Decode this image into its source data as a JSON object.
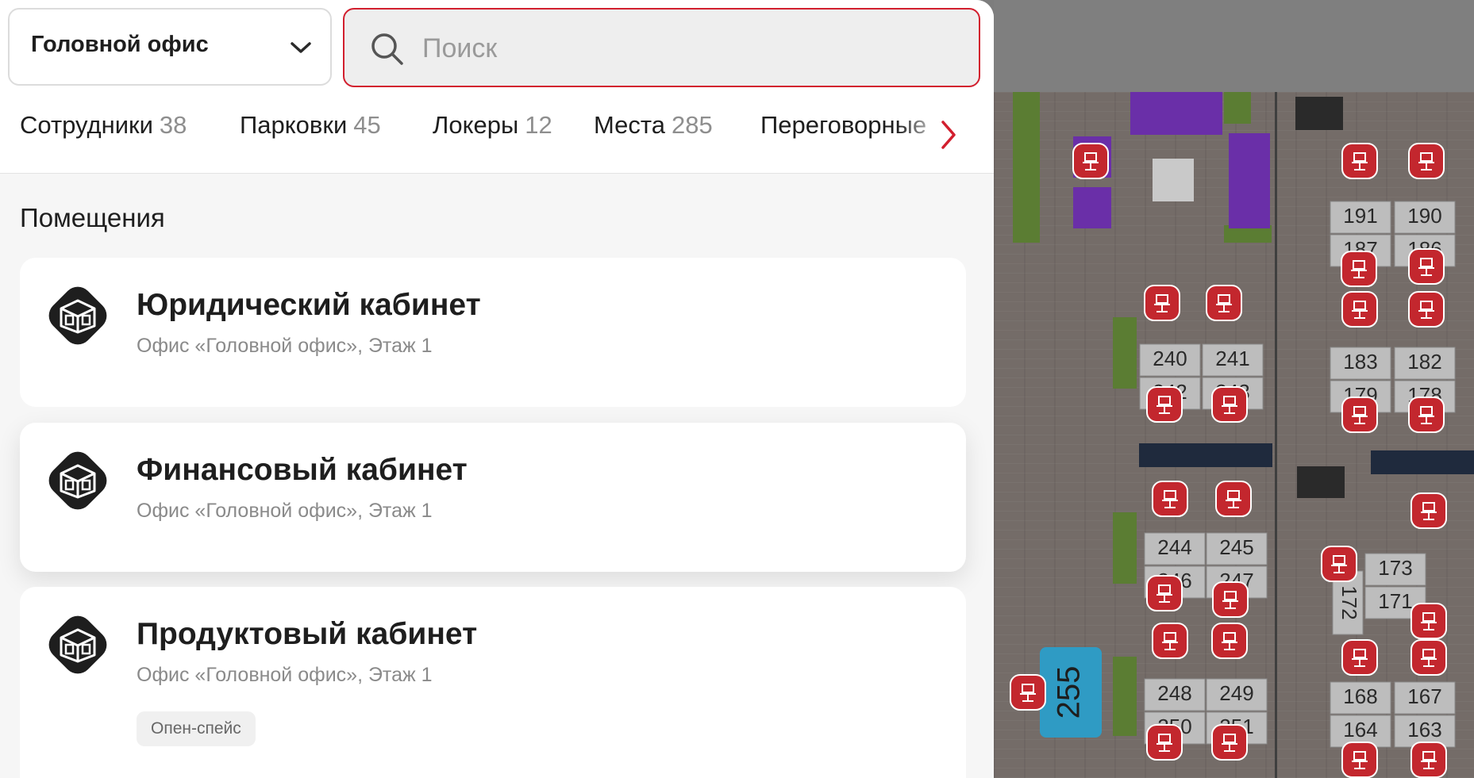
{
  "header": {
    "office_select": {
      "value": "Головной офис"
    },
    "search": {
      "placeholder": "Поиск",
      "value": ""
    }
  },
  "tabs": [
    {
      "label": "Сотрудники",
      "count": "38"
    },
    {
      "label": "Парковки",
      "count": "45"
    },
    {
      "label": "Локеры",
      "count": "12"
    },
    {
      "label": "Места",
      "count": "285"
    },
    {
      "label": "Переговорные",
      "count": ""
    }
  ],
  "section": {
    "title": "Помещения"
  },
  "rooms": [
    {
      "title": "Юридический кабинет",
      "subtitle": "Офис «Головной офис», Этаж 1",
      "tag": ""
    },
    {
      "title": "Финансовый кабинет",
      "subtitle": "Офис «Головной офис», Этаж 1",
      "tag": ""
    },
    {
      "title": "Продуктовый кабинет",
      "subtitle": "Офис «Головной офис», Этаж 1",
      "tag": "Опен-спейс"
    }
  ],
  "map": {
    "desks": [
      "191",
      "190",
      "187",
      "186",
      "240",
      "241",
      "242",
      "243",
      "183",
      "182",
      "179",
      "178",
      "244",
      "245",
      "246",
      "247",
      "173",
      "171",
      "172",
      "248",
      "249",
      "250",
      "251",
      "168",
      "167",
      "164",
      "163"
    ],
    "room_label": "255"
  },
  "colors": {
    "accent": "#d21f2e",
    "seat_marker": "#c3272e",
    "room_icon_bg": "#1e1e1e",
    "map_room": "#2f9bc4"
  },
  "icons": {
    "dropdown": "chevron-down-icon",
    "search": "search-icon",
    "tabs_scroll": "chevron-right-icon",
    "room": "room-3d-icon",
    "seat": "chair-icon"
  }
}
